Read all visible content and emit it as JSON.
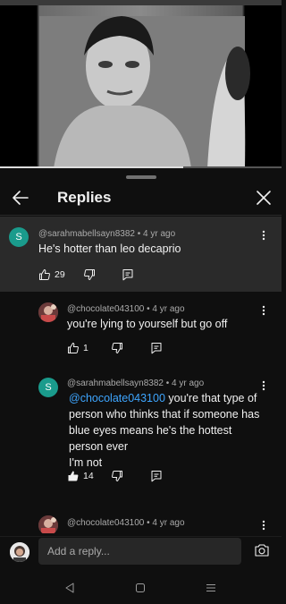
{
  "video": {
    "progress_fraction": 0.65
  },
  "header": {
    "title": "Replies",
    "back_icon": "arrow-left-icon",
    "close_icon": "close-icon"
  },
  "comments": [
    {
      "avatar_letter": "S",
      "avatar_color": "#1a9b8c",
      "meta": "@sarahmabellsayn8382 • 4 yr ago",
      "text": "He's hotter than leo decaprio",
      "like_count": "29",
      "liked": false
    },
    {
      "meta": "@chocolate043100 • 4 yr ago",
      "text": "you're lying to yourself but go off",
      "like_count": "1",
      "liked": false
    },
    {
      "avatar_letter": "S",
      "avatar_color": "#1a9b8c",
      "meta": "@sarahmabellsayn8382 • 4 yr ago",
      "mention": "@chocolate043100",
      "text_line1": " you're that type of",
      "text_line2": "person who thinks that if someone has",
      "text_line3": "blue eyes means he's the hottest",
      "text_line4": "person ever",
      "text_line5": "I'm not",
      "like_count": "14",
      "liked": true
    },
    {
      "meta": "@chocolate043100 • 4 yr ago"
    }
  ],
  "reply_bar": {
    "placeholder": "Add a reply..."
  },
  "colors": {
    "background": "#0f0f0f",
    "highlight": "#2a2a2a",
    "mention": "#3ea6ff",
    "muted_text": "#aaaaaa"
  }
}
